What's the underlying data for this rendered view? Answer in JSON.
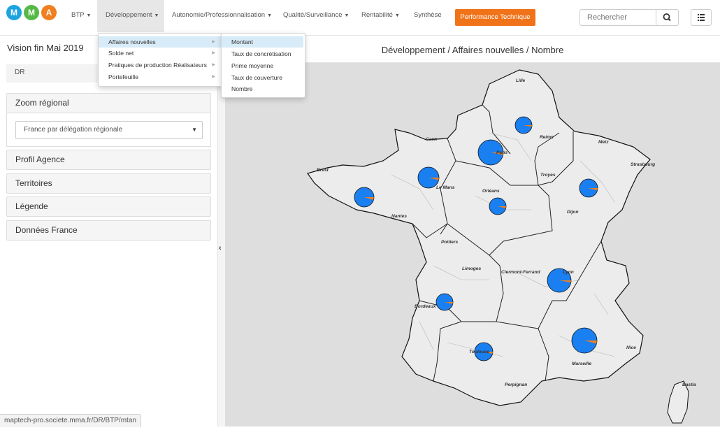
{
  "logos": [
    {
      "letter": "M",
      "color": "#1ba4e0"
    },
    {
      "letter": "M",
      "color": "#56b947"
    },
    {
      "letter": "A",
      "color": "#f07f1f"
    }
  ],
  "nav": {
    "items": [
      "BTP",
      "Développement",
      "Autonomie/Professionnalisation",
      "Qualité/Surveillance",
      "Rentabilité",
      "Synthèse"
    ],
    "performance_button": "Performance Technique",
    "search_placeholder": "Rechercher"
  },
  "sidebar": {
    "vision": "Vision fin Mai 2019",
    "dr_value": "DR",
    "panels": [
      "Zoom régional",
      "Profil Agence",
      "Territoires",
      "Légende",
      "Données France"
    ],
    "zoom_select": "France par délégation régionale"
  },
  "map": {
    "title": "Développement / Affaires nouvelles / Nombre",
    "cities": [
      "Lille",
      "Caen",
      "Reims",
      "Metz",
      "Brest",
      "Paris",
      "Strasbourg",
      "Troyes",
      "Le Mans",
      "Orléans",
      "Nantes",
      "Dijon",
      "Poitiers",
      "Limoges",
      "Clermont-Ferrand",
      "Lyon",
      "Bordeaux",
      "Toulouse",
      "Nice",
      "Marseille",
      "Perpignan",
      "Bastia"
    ],
    "pie_colors": {
      "main": "#1a7ff0",
      "slice": "#f07f1f"
    }
  },
  "dropdown": {
    "level1": [
      "Affaires nouvelles",
      "Solde net",
      "Pratiques de production Réalisateurs",
      "Portefeuille"
    ],
    "level2": [
      "Montant",
      "Taux de concrétisation",
      "Prime moyenne",
      "Taux de couverture",
      "Nombre"
    ]
  },
  "statusbar": "maptech-pro.societe.mma.fr/DR/BTP/mtan",
  "icons": {
    "search": "search-icon",
    "list": "list-icon",
    "collapse": "chevron-left-icon",
    "dropdown_caret": "caret-down-icon"
  }
}
